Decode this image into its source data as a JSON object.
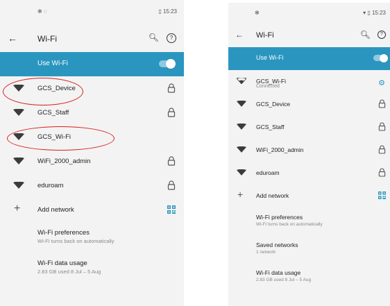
{
  "left": {
    "status": {
      "left_icons": "✻ ◌",
      "right": "▯ 15:23"
    },
    "toolbar": {
      "title": "Wi-Fi"
    },
    "use_wifi": {
      "label": "Use Wi-Fi",
      "enabled": true
    },
    "networks": [
      {
        "name": "GCS_Device",
        "secured": true
      },
      {
        "name": "GCS_Staff",
        "secured": true
      },
      {
        "name": "GCS_Wi-Fi",
        "secured": false
      },
      {
        "name": "WiFi_2000_admin",
        "secured": true
      },
      {
        "name": "eduroam",
        "secured": true
      }
    ],
    "add_network": "Add network",
    "prefs": [
      {
        "title": "Wi-Fi preferences",
        "subtitle": "Wi-Fi turns back on automatically"
      },
      {
        "title": "Wi-Fi data usage",
        "subtitle": "2.83 GB used 8 Jul – 5 Aug"
      }
    ]
  },
  "right": {
    "status": {
      "left_icons": "✻",
      "right": "▾ ▯ 15:23"
    },
    "toolbar": {
      "title": "Wi-Fi"
    },
    "use_wifi": {
      "label": "Use Wi-Fi",
      "enabled": true
    },
    "connected": {
      "name": "GCS_Wi-Fi",
      "status": "Connected"
    },
    "networks": [
      {
        "name": "GCS_Device",
        "secured": true
      },
      {
        "name": "GCS_Staff",
        "secured": true
      },
      {
        "name": "WiFi_2000_admin",
        "secured": true
      },
      {
        "name": "eduroam",
        "secured": true
      }
    ],
    "add_network": "Add network",
    "prefs": [
      {
        "title": "Wi-Fi preferences",
        "subtitle": "Wi-Fi turns back on automatically"
      },
      {
        "title": "Saved networks",
        "subtitle": "1 network"
      },
      {
        "title": "Wi-Fi data usage",
        "subtitle": "2.83 GB used 8 Jul – 5 Aug"
      }
    ]
  },
  "icons": {
    "back": "arrow-left-icon",
    "search": "search-icon",
    "help": "help-circle-icon",
    "wifi": "wifi-signal-icon",
    "lock": "lock-icon",
    "settings": "gear-icon",
    "add": "plus-icon",
    "qr": "qr-code-icon"
  },
  "colors": {
    "accent": "#2a96bf",
    "annotation": "#d81b1b",
    "background": "#f3f3f3"
  }
}
